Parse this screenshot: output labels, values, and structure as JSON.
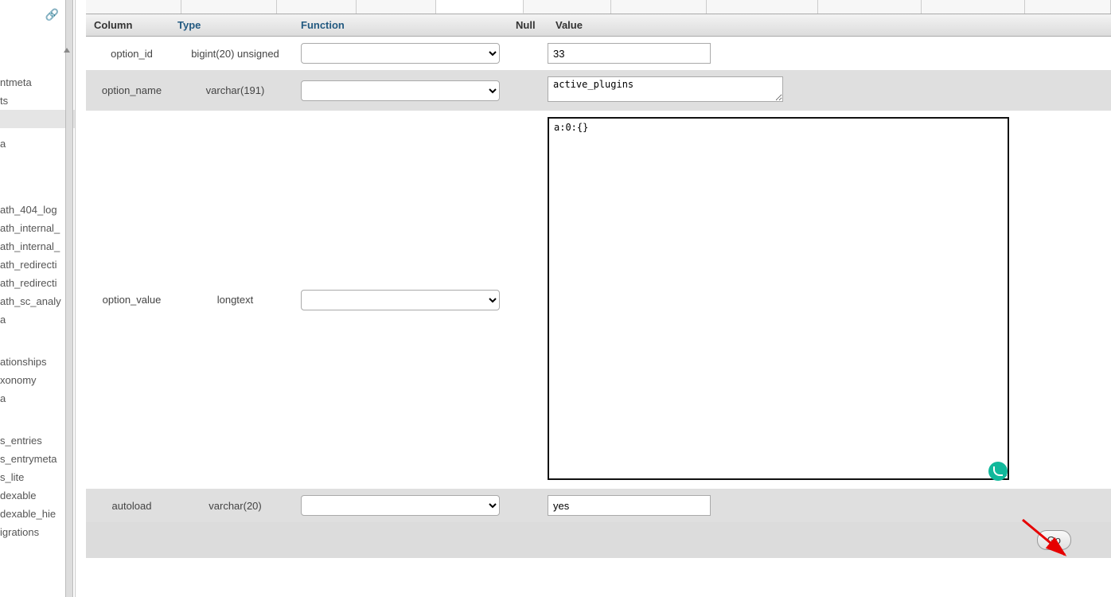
{
  "headers": {
    "column": "Column",
    "type": "Type",
    "function": "Function",
    "null": "Null",
    "value": "Value"
  },
  "rows": [
    {
      "column": "option_id",
      "type": "bigint(20) unsigned",
      "value": "33"
    },
    {
      "column": "option_name",
      "type": "varchar(191)",
      "value": "active_plugins"
    },
    {
      "column": "option_value",
      "type": "longtext",
      "value": "a:0:{}"
    },
    {
      "column": "autoload",
      "type": "varchar(20)",
      "value": "yes"
    }
  ],
  "go_label": "Go",
  "sidebar_items": [
    "",
    "",
    "ntmeta",
    "ts",
    "",
    "a",
    "",
    "",
    "",
    "",
    "ath_404_log",
    "ath_internal_",
    "ath_internal_",
    "ath_redirecti",
    "ath_redirecti",
    "ath_sc_analy",
    "a",
    "",
    "",
    "ationships",
    "xonomy",
    "a",
    "",
    "",
    "s_entries",
    "s_entrymeta",
    "s_lite",
    "dexable",
    "dexable_hie",
    "igrations"
  ]
}
